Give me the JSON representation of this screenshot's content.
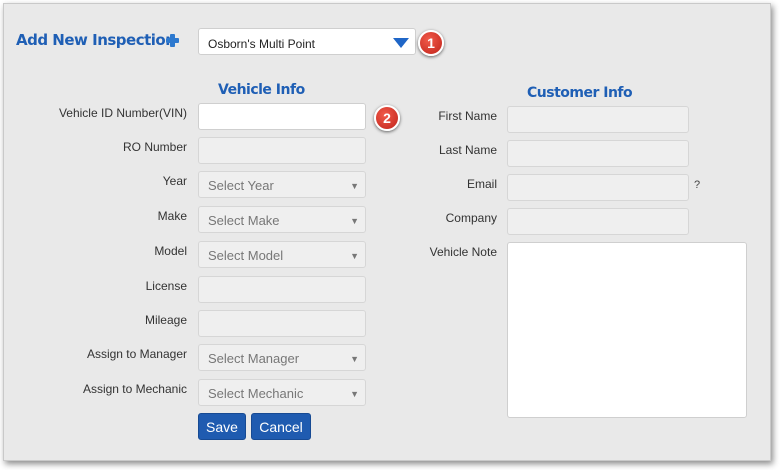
{
  "header": {
    "title": "Add New Inspection",
    "inspection_type": "Osborn's Multi Point"
  },
  "badges": {
    "step1": "1",
    "step2": "2"
  },
  "vehicle_info": {
    "heading": "Vehicle Info",
    "vin_label": "Vehicle ID Number(VIN)",
    "vin_value": "",
    "ro_label": "RO Number",
    "year_label": "Year",
    "year_placeholder": "Select Year",
    "make_label": "Make",
    "make_placeholder": "Select Make",
    "model_label": "Model",
    "model_placeholder": "Select Model",
    "license_label": "License",
    "mileage_label": "Mileage",
    "manager_label": "Assign to Manager",
    "manager_placeholder": "Select Manager",
    "mechanic_label": "Assign to Mechanic",
    "mechanic_placeholder": "Select Mechanic"
  },
  "customer_info": {
    "heading": "Customer Info",
    "first_name_label": "First Name",
    "last_name_label": "Last Name",
    "email_label": "Email",
    "email_help": "?",
    "company_label": "Company",
    "vehicle_note_label": "Vehicle Note"
  },
  "actions": {
    "save": "Save",
    "cancel": "Cancel"
  },
  "colors": {
    "accent": "#1f5fb5",
    "badge": "#d9342b",
    "button": "#1f5bb0"
  }
}
